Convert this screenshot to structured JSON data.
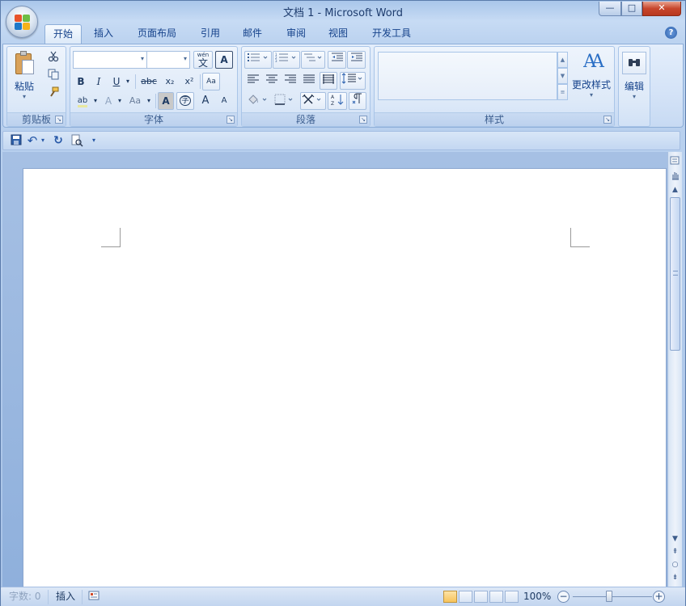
{
  "window": {
    "title": "文档 1 - Microsoft Word",
    "min_glyph": "—",
    "max_glyph": "□",
    "close_glyph": "✕"
  },
  "tabs": [
    {
      "label": "开始",
      "active": true
    },
    {
      "label": "插入"
    },
    {
      "label": "页面布局"
    },
    {
      "label": "引用"
    },
    {
      "label": "邮件"
    },
    {
      "label": "审阅"
    },
    {
      "label": "视图"
    },
    {
      "label": "开发工具"
    }
  ],
  "help_glyph": "?",
  "ribbon": {
    "clipboard": {
      "label": "剪贴板",
      "paste": "粘贴",
      "paste_arrow": "▾",
      "icons": [
        "cut-icon",
        "copy-icon",
        "format-painter-icon"
      ]
    },
    "font": {
      "label": "字体",
      "font_name": "",
      "font_size": "",
      "combo_arrow": "▾",
      "phonetic_glyph": "wén",
      "phonetic_char": "文",
      "char_border_glyph": "A",
      "bold": "B",
      "italic": "I",
      "underline": "U",
      "strike": "abc",
      "subscript": "x₂",
      "superscript": "x²",
      "clear_format": "Aa",
      "highlight": "ab",
      "font_color": "A",
      "change_case": "Aa",
      "char_shading": "A",
      "enclose_char": "字",
      "grow_font": "A",
      "shrink_font": "A"
    },
    "paragraph": {
      "label": "段落"
    },
    "styles": {
      "label": "样式",
      "change_styles": "更改样式",
      "change_styles_icon": "AA",
      "arrow": "▾",
      "scroll_up": "▲",
      "scroll_down": "▼",
      "more": "≡"
    },
    "editing": {
      "label": "编辑",
      "icon_glyph": "⚲",
      "arrow": "▾"
    },
    "launcher_glyph": "↘"
  },
  "qat": {
    "save_icon": "save-icon",
    "undo_glyph": "↶",
    "undo_arrow": "▾",
    "redo_glyph": "↻",
    "print_preview_glyph": "🔍",
    "customize_glyph": "▾"
  },
  "scrollbar": {
    "up": "▲",
    "down": "▼",
    "prev_page": "⇞",
    "select_browse": "○",
    "next_page": "⇟"
  },
  "statusbar": {
    "word_count": "字数: 0",
    "insert_mode": "插入",
    "zoom": "100%",
    "zoom_minus": "−",
    "zoom_plus": "+"
  },
  "colors": {
    "accent": "#15428b",
    "ribbon_bg": "#dbe7f8",
    "active_view": "#f7c35b"
  }
}
